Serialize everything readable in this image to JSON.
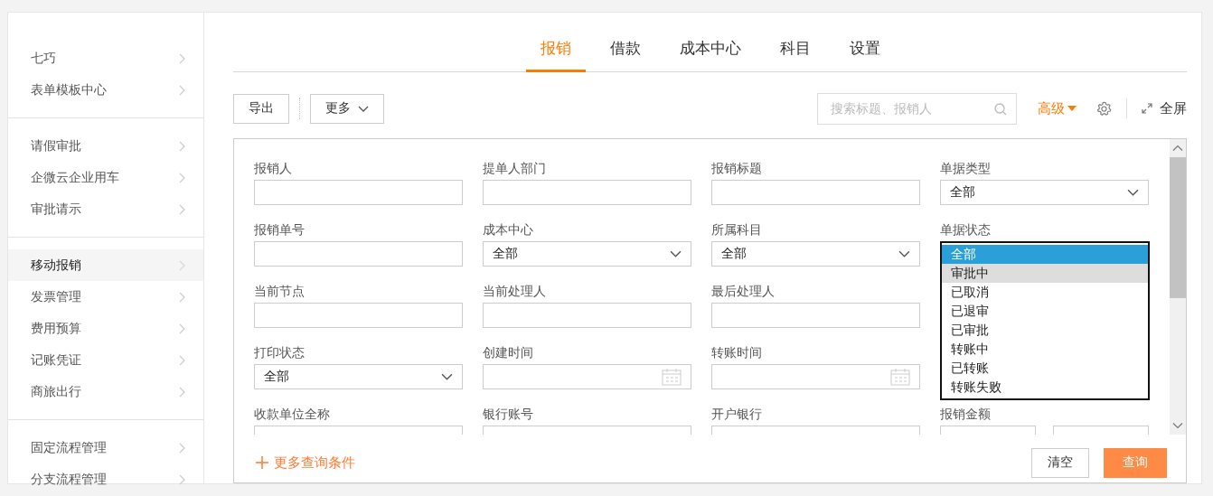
{
  "sidebar": {
    "groups": [
      {
        "items": [
          {
            "label": "七巧",
            "selected": false
          },
          {
            "label": "表单模板中心",
            "selected": false
          }
        ]
      },
      {
        "items": [
          {
            "label": "请假审批",
            "selected": false
          },
          {
            "label": "企微云企业用车",
            "selected": false
          },
          {
            "label": "审批请示",
            "selected": false
          }
        ]
      },
      {
        "items": [
          {
            "label": "移动报销",
            "selected": true
          },
          {
            "label": "发票管理",
            "selected": false
          },
          {
            "label": "费用预算",
            "selected": false
          },
          {
            "label": "记账凭证",
            "selected": false
          },
          {
            "label": "商旅出行",
            "selected": false
          }
        ]
      },
      {
        "items": [
          {
            "label": "固定流程管理",
            "selected": false
          },
          {
            "label": "分支流程管理",
            "selected": false
          }
        ]
      }
    ]
  },
  "tabs": [
    {
      "label": "报销",
      "selected": true
    },
    {
      "label": "借款",
      "selected": false
    },
    {
      "label": "成本中心",
      "selected": false
    },
    {
      "label": "科目",
      "selected": false
    },
    {
      "label": "设置",
      "selected": false
    }
  ],
  "toolbar": {
    "export_button": "导出",
    "more_button": "更多",
    "search": {
      "placeholder": "搜索标题、报销人"
    },
    "advanced": "高级",
    "fullscreen": "全屏"
  },
  "filters": {
    "rows": [
      {
        "fields": [
          {
            "label": "报销人",
            "kind": "text"
          },
          {
            "label": "提单人部门",
            "kind": "text"
          },
          {
            "label": "报销标题",
            "kind": "text"
          },
          {
            "label": "单据类型",
            "kind": "select",
            "value": "全部"
          }
        ]
      },
      {
        "fields": [
          {
            "label": "报销单号",
            "kind": "text"
          },
          {
            "label": "成本中心",
            "kind": "select",
            "value": "全部"
          },
          {
            "label": "所属科目",
            "kind": "select",
            "value": "全部"
          },
          {
            "label": "单据状态",
            "kind": "listbox",
            "options": [
              {
                "label": "全部",
                "selected": true,
                "hovered": false
              },
              {
                "label": "审批中",
                "selected": false,
                "hovered": true
              },
              {
                "label": "已取消",
                "selected": false,
                "hovered": false
              },
              {
                "label": "已退审",
                "selected": false,
                "hovered": false
              },
              {
                "label": "已审批",
                "selected": false,
                "hovered": false
              },
              {
                "label": "转账中",
                "selected": false,
                "hovered": false
              },
              {
                "label": "已转账",
                "selected": false,
                "hovered": false
              },
              {
                "label": "转账失败",
                "selected": false,
                "hovered": false
              }
            ]
          }
        ]
      },
      {
        "fields": [
          {
            "label": "当前节点",
            "kind": "text"
          },
          {
            "label": "当前处理人",
            "kind": "text"
          },
          {
            "label": "最后处理人",
            "kind": "text"
          }
        ]
      },
      {
        "fields": [
          {
            "label": "打印状态",
            "kind": "select",
            "value": "全部"
          },
          {
            "label": "创建时间",
            "kind": "date"
          },
          {
            "label": "转账时间",
            "kind": "date"
          }
        ]
      },
      {
        "fields": [
          {
            "label": "收款单位全称",
            "kind": "text"
          },
          {
            "label": "银行账号",
            "kind": "text"
          },
          {
            "label": "开户银行",
            "kind": "text"
          },
          {
            "label": "报销金额",
            "kind": "range"
          }
        ]
      }
    ],
    "more_conditions": "更多查询条件",
    "clear_button": "清空",
    "query_button": "查询"
  }
}
